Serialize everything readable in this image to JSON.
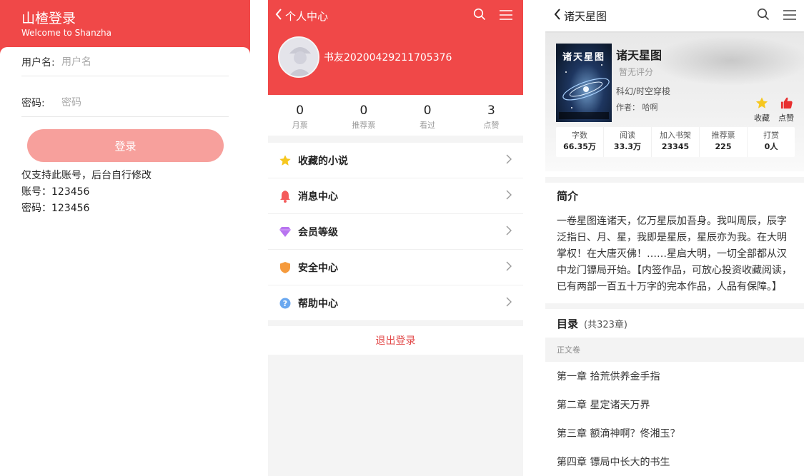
{
  "login": {
    "title": "山楂登录",
    "subtitle": "Welcome to Shanzha",
    "username_label": "用户名:",
    "username_placeholder": "用户名",
    "password_label": "密码:",
    "password_placeholder": "密码",
    "button": "登录",
    "notes": [
      "仅支持此账号，后台自行修改",
      "账号：123456",
      "密码：123456"
    ]
  },
  "profile": {
    "nav_title": "个人中心",
    "username": "书友20200429211705376",
    "stats": [
      {
        "num": "0",
        "label": "月票"
      },
      {
        "num": "0",
        "label": "推荐票"
      },
      {
        "num": "0",
        "label": "看过"
      },
      {
        "num": "3",
        "label": "点赞"
      }
    ],
    "menu": [
      {
        "label": "收藏的小说",
        "icon": "star-icon"
      },
      {
        "label": "消息中心",
        "icon": "bell-icon"
      },
      {
        "label": "会员等级",
        "icon": "diamond-icon"
      },
      {
        "label": "安全中心",
        "icon": "shield-icon"
      },
      {
        "label": "帮助中心",
        "icon": "help-icon"
      }
    ],
    "logout": "退出登录"
  },
  "book": {
    "nav_title": "诸天星图",
    "cover_text": "诸天星图",
    "title": "诸天星图",
    "score": "暂无评分",
    "category": "科幻/时空穿梭",
    "author": "作者：  哈啊",
    "collect": "收藏",
    "like": "点赞",
    "stats": [
      {
        "label": "字数",
        "value": "66.35万"
      },
      {
        "label": "阅读",
        "value": "33.3万"
      },
      {
        "label": "加入书架",
        "value": "23345"
      },
      {
        "label": "推荐票",
        "value": "225"
      },
      {
        "label": "打赏",
        "value": "0人"
      }
    ],
    "intro_title": "简介",
    "intro": "一卷星图连诸天，亿万星辰加吾身。我叫周辰，辰字泛指日、月、星，我即是星辰，星辰亦为我。在大明掌权！在大唐灭佛！……星启大明，一切全部都从汉中龙门镖局开始。【内签作品，可放心投资收藏阅读，已有两部一百五十万字的完本作品，人品有保障。】",
    "toc_title": "目录",
    "toc_count": "(共323章)",
    "volume": "正文卷",
    "chapters": [
      "第一章 拾荒供养金手指",
      "第二章 星定诸天万界",
      "第三章 额滴神啊？佟湘玉？",
      "第四章 镖局中长大的书生"
    ]
  },
  "colors": {
    "brand": "#f04848",
    "button_disabled": "#f7a09c"
  }
}
